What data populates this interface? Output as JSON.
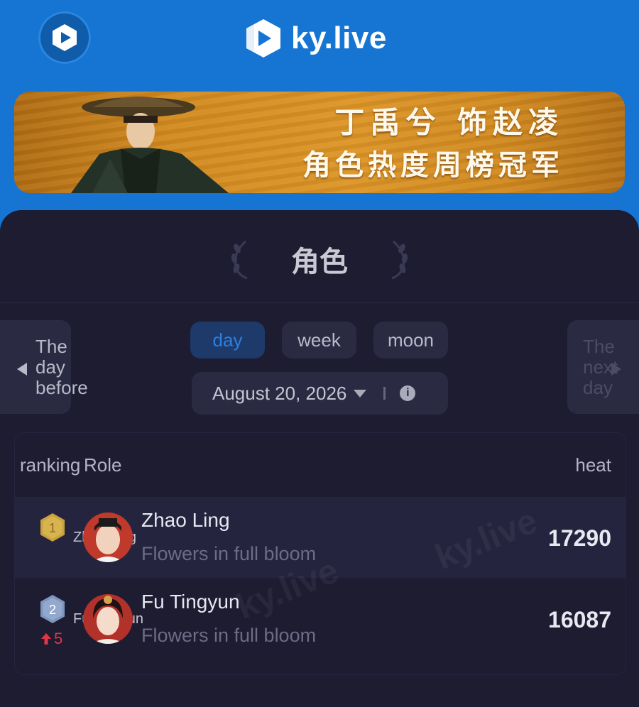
{
  "header": {
    "brand_name": "ky.live",
    "icon": "play-logo-icon",
    "brand_color": "#1675d3"
  },
  "banner": {
    "line1": "丁禹兮 饰赵凌",
    "line2": "角色热度周榜冠军"
  },
  "section": {
    "title": "角色"
  },
  "period_tabs": [
    {
      "label": "day",
      "active": true
    },
    {
      "label": "week",
      "active": false
    },
    {
      "label": "moon",
      "active": false
    }
  ],
  "date_picker": {
    "value": "August 20, 2026",
    "info_icon": "info-icon"
  },
  "day_nav": {
    "prev_label": "The day before",
    "next_label": "The next day"
  },
  "table": {
    "headers": {
      "ranking": "ranking",
      "role": "Role",
      "heat": "heat"
    },
    "rows": [
      {
        "rank": "1",
        "avatar_alt": "Zhao Ling",
        "name": "Zhao Ling",
        "drama": "Flowers in full bloom",
        "heat": "17290",
        "change": ""
      },
      {
        "rank": "2",
        "avatar_alt": "Fu Tingyun",
        "name": "Fu Tingyun",
        "drama": "Flowers in full bloom",
        "heat": "16087",
        "change": "5"
      }
    ]
  },
  "colors": {
    "active_tab": "#2d7fe0",
    "gold_badge": "#c9a23a",
    "silver_badge": "#7f95bd",
    "rise": "#e0354a"
  }
}
